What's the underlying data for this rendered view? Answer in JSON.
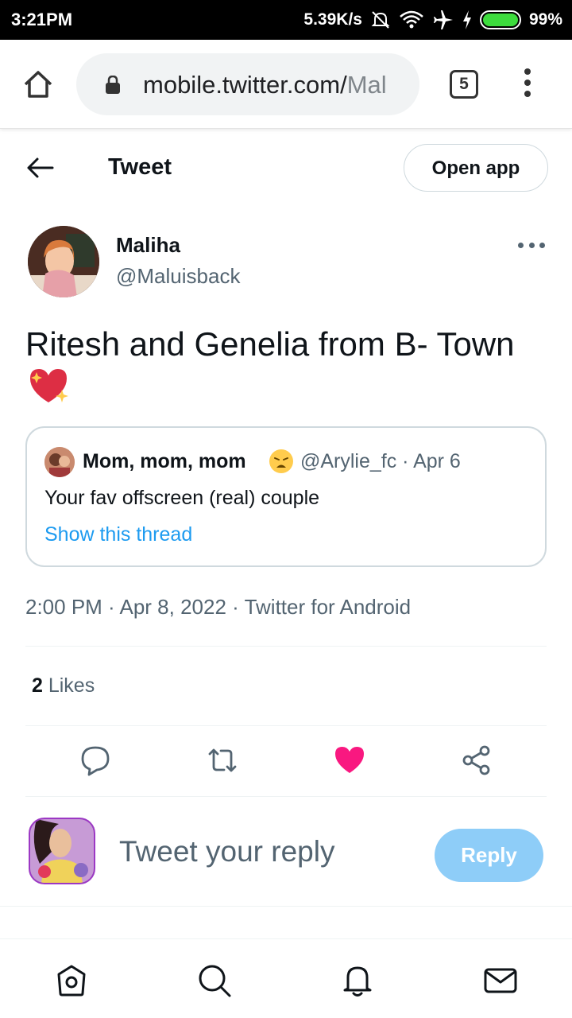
{
  "status_bar": {
    "time": "3:21PM",
    "network_speed": "5.39K/s",
    "battery": "99%",
    "battery_level": 0.99,
    "icons": [
      "mute-icon",
      "wifi-icon",
      "airplane-icon",
      "charging-icon",
      "battery-icon"
    ]
  },
  "browser": {
    "url_main": "mobile.twitter.com/",
    "url_dim": "Mal",
    "tab_count": "5",
    "icons": [
      "home-icon",
      "lock-icon",
      "overflow-menu-icon"
    ]
  },
  "header": {
    "title": "Tweet",
    "open_app_label": "Open app"
  },
  "tweet": {
    "author_name": "Maliha",
    "author_handle": "@Maluisback",
    "text": "Ritesh and Genelia from B- Town",
    "emoji": "sparkling-heart",
    "timestamp": "2:00 PM · Apr 8, 2022 · Twitter for Android",
    "likes_count": "2",
    "likes_label": " Likes"
  },
  "quoted_tweet": {
    "author_name": "Mom, mom, mom",
    "emoji": "weary-face",
    "meta": "@Arylie_fc · Apr 6",
    "text": "Your fav offscreen (real) couple",
    "thread_link": "Show this thread"
  },
  "actions": {
    "icons": [
      "reply-icon",
      "retweet-icon",
      "like-icon",
      "share-icon"
    ],
    "liked": true,
    "like_color": "#f91880"
  },
  "reply": {
    "placeholder": "Tweet your reply",
    "button_label": "Reply"
  },
  "bottom_nav": {
    "icons": [
      "home-icon",
      "search-icon",
      "notifications-icon",
      "messages-icon"
    ]
  },
  "colors": {
    "accent": "#1d9bf0",
    "reply_button": "#8ecdf8",
    "secondary_text": "#536471"
  }
}
